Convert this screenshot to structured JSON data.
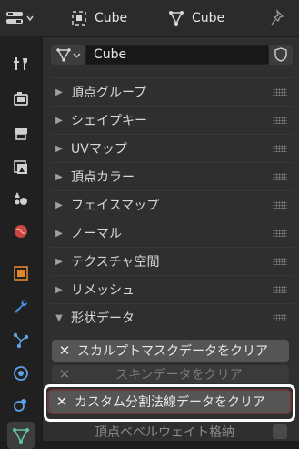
{
  "topbar": {
    "object_name": "Cube",
    "mesh_name": "Cube"
  },
  "datablock": {
    "name": "Cube"
  },
  "panels": [
    {
      "label": "頂点グループ",
      "expanded": false
    },
    {
      "label": "シェイプキー",
      "expanded": false
    },
    {
      "label": "UVマップ",
      "expanded": false
    },
    {
      "label": "頂点カラー",
      "expanded": false
    },
    {
      "label": "フェイスマップ",
      "expanded": false
    },
    {
      "label": "ノーマル",
      "expanded": false
    },
    {
      "label": "テクスチャ空間",
      "expanded": false
    },
    {
      "label": "リメッシュ",
      "expanded": false
    },
    {
      "label": "形状データ",
      "expanded": true
    }
  ],
  "geometry_buttons": {
    "clear_sculpt_mask": "スカルプトマスクデータをクリア",
    "clear_skin": "スキンデータをクリア",
    "clear_custom_normals": "カスタム分割法線データをクリア"
  },
  "bottom_option": {
    "label": "頂点ベベルウェイト格納"
  },
  "colors": {
    "accent_green": "#5fc2a6",
    "accent_orange": "#e0862f",
    "highlight_border": "#ffffff"
  }
}
